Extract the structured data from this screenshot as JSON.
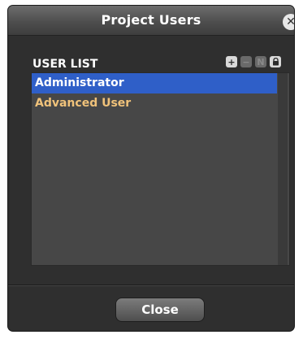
{
  "dialog": {
    "title": "Project Users",
    "close_icon_glyph": "✕"
  },
  "user_list": {
    "label": "USER LIST",
    "toolbar": {
      "add_glyph": "+",
      "remove_glyph": "−",
      "rename_glyph": "N",
      "lock_glyph": "🔒"
    },
    "items": [
      {
        "label": "Administrator",
        "selected": true
      },
      {
        "label": "Advanced User",
        "selected": false
      }
    ]
  },
  "footer": {
    "close_label": "Close"
  },
  "colors": {
    "selection": "#2f5fc8",
    "user_text": "#f0c27a"
  }
}
